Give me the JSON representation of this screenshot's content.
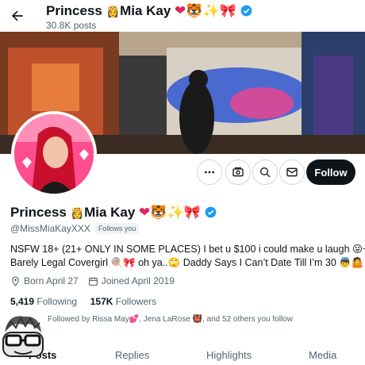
{
  "header": {
    "display_name": "Princess",
    "display_name_tail": "Mia Kay",
    "posts_count": "30.8K posts"
  },
  "profile": {
    "name": "Princess",
    "name_tail": "Mia Kay",
    "handle": "@MissMiaKayXXX",
    "follows_you": "Follows you",
    "bio_line1": "NSFW 18+ (21+ ONLY IN SOME PLACES) I bet u $100 i could make u laugh",
    "bio_line2": "Barely Legal Covergirl",
    "bio_line2b": "oh ya..",
    "bio_line2c": "Daddy Says I Can’t Date Till I’m 30",
    "born": "Born April 27",
    "joined": "Joined April 2019",
    "following_count": "5,419",
    "following_label": "Following",
    "followers_count": "157K",
    "followers_label": "Followers",
    "followed_by": "Followed by Rissa May",
    "followed_by_2": ", Jena LaRose",
    "followed_by_3": ", and 52 others you follow"
  },
  "actions": {
    "follow_label": "Follow"
  },
  "tabs": [
    {
      "label": "Posts"
    },
    {
      "label": "Replies"
    },
    {
      "label": "Highlights"
    },
    {
      "label": "Media"
    }
  ],
  "colors": {
    "accent": "#1d9bf0",
    "avatar_ring": "#ff3d8a",
    "follow_bg": "#0f1419"
  },
  "icons": [
    "back-arrow-icon",
    "verified-badge-icon",
    "more-icon",
    "subscribe-icon",
    "search-icon",
    "message-icon",
    "location-icon",
    "calendar-icon"
  ]
}
